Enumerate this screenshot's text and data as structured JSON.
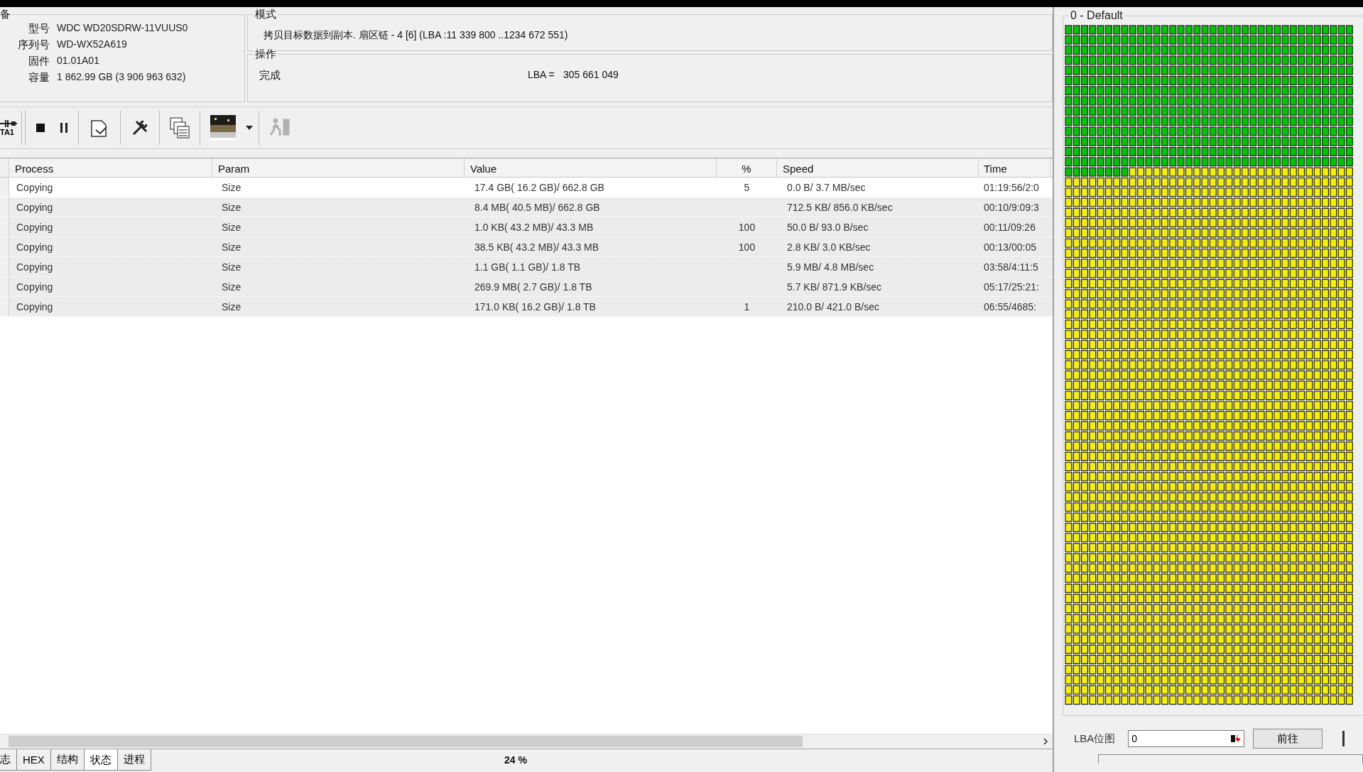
{
  "device": {
    "title": "备",
    "fields": [
      {
        "label": "型号",
        "value": "WDC WD20SDRW-11VUUS0"
      },
      {
        "label": "序列号",
        "value": "WD-WX52A619"
      },
      {
        "label": "固件",
        "value": "01.01A01"
      },
      {
        "label": "容量",
        "value": "1 862.99 GB (3 906 963 632)"
      }
    ]
  },
  "mode": {
    "title": "模式",
    "text": "拷贝目标数据到副本. 扇区链 - 4 [6] (LBA :11 339 800 ..1234 672 551)"
  },
  "operation": {
    "title": "操作",
    "status": "完成",
    "lba_label": "LBA =",
    "lba_value": "305 661 049"
  },
  "toolbar": {
    "port_label": "TA1",
    "buttons": [
      {
        "kind": "stop",
        "disabled": false
      },
      {
        "kind": "pause",
        "disabled": false
      },
      {
        "kind": "document",
        "disabled": false
      },
      {
        "kind": "tools",
        "disabled": false
      },
      {
        "kind": "windows",
        "disabled": false
      },
      {
        "kind": "thumbnail",
        "disabled": false
      },
      {
        "kind": "runner",
        "disabled": true
      }
    ]
  },
  "table": {
    "columns": [
      "Process",
      "Param",
      "Value",
      "%",
      "Speed",
      "Time"
    ],
    "rows": [
      {
        "selected": true,
        "cells": [
          "Copying",
          "Size",
          "17.4 GB( 16.2 GB)/ 662.8 GB",
          "5",
          "0.0 B/ 3.7 MB/sec",
          "01:19:56/2:0"
        ]
      },
      {
        "selected": false,
        "cells": [
          "Copying",
          "Size",
          "8.4 MB( 40.5 MB)/ 662.8 GB",
          "",
          "712.5 KB/ 856.0 KB/sec",
          "00:10/9:09:3"
        ]
      },
      {
        "selected": false,
        "cells": [
          "Copying",
          "Size",
          "1.0 KB( 43.2 MB)/ 43.3 MB",
          "100",
          "50.0 B/ 93.0 B/sec",
          "00:11/09:26"
        ]
      },
      {
        "selected": false,
        "cells": [
          "Copying",
          "Size",
          "38.5 KB( 43.2 MB)/ 43.3 MB",
          "100",
          "2.8 KB/ 3.0 KB/sec",
          "00:13/00:05"
        ]
      },
      {
        "selected": false,
        "cells": [
          "Copying",
          "Size",
          "1.1 GB( 1.1 GB)/ 1.8 TB",
          "",
          "5.9 MB/ 4.8 MB/sec",
          "03:58/4:11:5"
        ]
      },
      {
        "selected": false,
        "cells": [
          "Copying",
          "Size",
          "269.9 MB( 2.7 GB)/ 1.8 TB",
          "",
          "5.7 KB/ 871.9 KB/sec",
          "05:17/25:21:"
        ]
      },
      {
        "selected": false,
        "cells": [
          "Copying",
          "Size",
          "171.0 KB( 16.2 GB)/ 1.8 TB",
          "1",
          "210.0 B/ 421.0 B/sec",
          "06:55/4685:"
        ]
      }
    ]
  },
  "bottom_tabs": [
    {
      "label": "志",
      "selected": false
    },
    {
      "label": "HEX",
      "selected": false
    },
    {
      "label": "结构",
      "selected": false
    },
    {
      "label": "状态",
      "selected": true
    },
    {
      "label": "进程",
      "selected": false
    }
  ],
  "progress_text": "24 %",
  "map_panel": {
    "title": "0 - Default",
    "level": 0.2123,
    "lba_label": "LBA位图",
    "lba_input": "0",
    "go_button": "前往"
  }
}
